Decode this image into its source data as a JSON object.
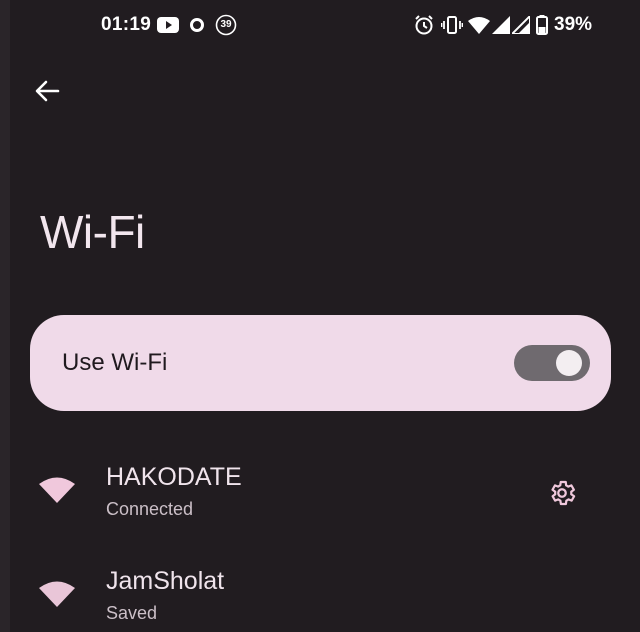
{
  "status_bar": {
    "time": "01:19",
    "notification_count": "39",
    "battery_percent": "39%",
    "icons": [
      "youtube-icon",
      "circle-notification-icon",
      "count-badge-icon",
      "alarm-icon",
      "vibrate-icon",
      "wifi-signal-icon",
      "cell-signal-icon",
      "cell-signal-icon",
      "battery-icon"
    ]
  },
  "header": {
    "back_icon": "arrow-left-icon",
    "title": "Wi-Fi"
  },
  "master_switch": {
    "label": "Use Wi-Fi",
    "state": "on"
  },
  "networks": [
    {
      "name": "HAKODATE",
      "status": "Connected",
      "icon": "wifi-icon",
      "has_settings": true,
      "settings_icon": "gear-icon"
    },
    {
      "name": "JamSholat",
      "status": "Saved",
      "icon": "wifi-icon",
      "has_settings": false
    }
  ],
  "colors": {
    "background": "#211c20",
    "card": "#f0dae9",
    "accent_icon": "#f0c8dc",
    "switch_track": "#6f6a6f"
  }
}
